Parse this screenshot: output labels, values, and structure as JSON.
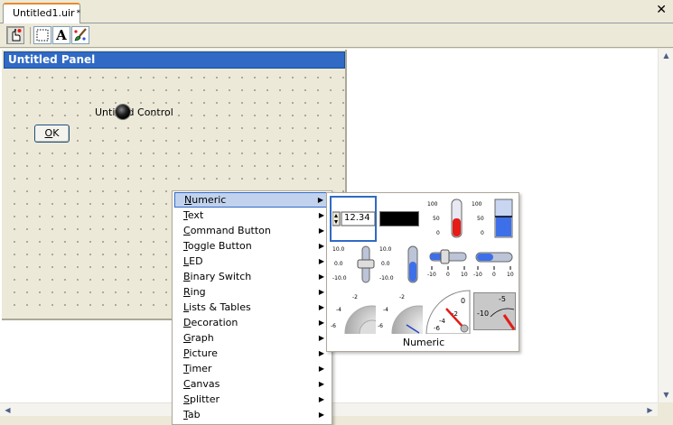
{
  "tabs": [
    {
      "label": "Untitled1.uir",
      "dirty_mark": "*"
    }
  ],
  "close_icon": "close-icon",
  "toolbar": {
    "tools": [
      {
        "name": "operate-tool",
        "icon": "hand-pointer-icon"
      },
      {
        "name": "edit-tool",
        "icon": "selection-rect-icon"
      },
      {
        "name": "label-tool",
        "icon": "text-a-icon"
      },
      {
        "name": "color-tool",
        "icon": "paintbrush-icon"
      }
    ]
  },
  "panel": {
    "title": "Untitled Panel",
    "ok_button": {
      "prefix": "",
      "mnemonic": "O",
      "suffix": "K"
    },
    "control_label": "Untitled Control"
  },
  "menu": {
    "items": [
      {
        "label": "Numeric",
        "mnemonic_index": 0,
        "selected": true
      },
      {
        "label": "Text",
        "mnemonic_index": 0
      },
      {
        "label": "Command Button",
        "mnemonic_index": 0
      },
      {
        "label": "Toggle Button",
        "mnemonic_index": 0
      },
      {
        "label": "LED",
        "mnemonic_index": 0
      },
      {
        "label": "Binary Switch",
        "mnemonic_index": 0
      },
      {
        "label": "Ring",
        "mnemonic_index": 0
      },
      {
        "label": "Lists & Tables",
        "mnemonic_index": 0
      },
      {
        "label": "Decoration",
        "mnemonic_index": 0
      },
      {
        "label": "Graph",
        "mnemonic_index": 0
      },
      {
        "label": "Picture",
        "mnemonic_index": 0
      },
      {
        "label": "Timer",
        "mnemonic_index": 0
      },
      {
        "label": "Canvas",
        "mnemonic_index": 0
      },
      {
        "label": "Splitter",
        "mnemonic_index": 0
      },
      {
        "label": "Tab",
        "mnemonic_index": 0
      }
    ]
  },
  "palette": {
    "caption": "Numeric",
    "numeric_value": "12.34",
    "tank_ticks": [
      "100",
      "50",
      "0"
    ],
    "slider_ticks_v": [
      "10.0",
      "0.0",
      "-10.0"
    ],
    "slider_ticks_h": [
      "-10",
      "0",
      "10"
    ],
    "knob_ticks": [
      "-2",
      "-4",
      "-6"
    ],
    "meter_ticks": [
      "0",
      "-2",
      "-4",
      "-6"
    ],
    "gauge_ticks": [
      "-5",
      "-10"
    ],
    "colors": {
      "accent": "#316ac5",
      "fill_red": "#e41b17",
      "fill_blue": "#3d6fe8"
    }
  }
}
